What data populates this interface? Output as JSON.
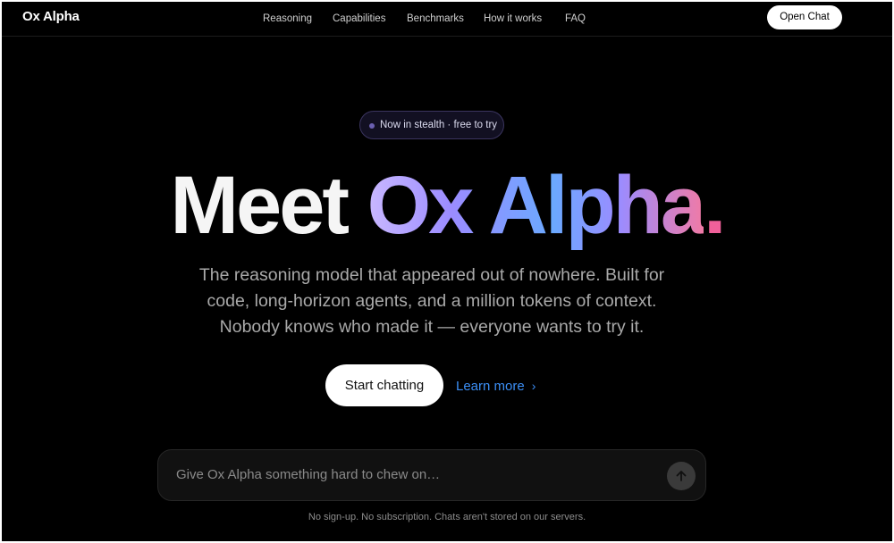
{
  "nav": {
    "brand": "Ox Alpha",
    "links": [
      "Reasoning",
      "Capabilities",
      "Benchmarks",
      "How it works",
      "FAQ"
    ],
    "open_chat": "Open Chat"
  },
  "hero": {
    "badge": "Now in stealth · free to try",
    "headline_lead": "Meet",
    "headline_brand": "Ox Alpha",
    "headline_period": ".",
    "subtitle_lines": [
      "The reasoning model that appeared out of nowhere. Built for",
      "code, long-horizon agents, and a million tokens of context.",
      "Nobody knows who made it — everyone wants to try it."
    ],
    "cta_primary": "Start chatting",
    "cta_secondary": "Learn more",
    "cta_secondary_chevron": "›"
  },
  "prompt": {
    "placeholder": "Give Ox Alpha something hard to chew on…",
    "value": "",
    "send_icon": "arrow-up-icon"
  },
  "footnote": "No sign-up. No subscription. Chats aren't stored on our servers.",
  "colors": {
    "background": "#000000",
    "accent_link": "#3b8ef5",
    "gradient_start": "#c9b8ff",
    "gradient_mid": "#6aa9ff",
    "gradient_end": "#f07aa6"
  }
}
